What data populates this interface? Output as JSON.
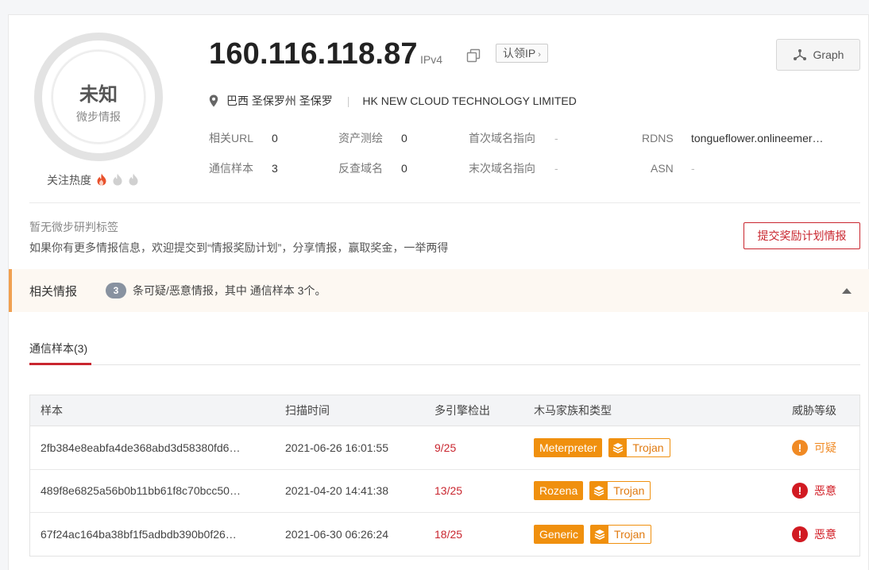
{
  "score": {
    "verdict": "未知",
    "source": "微步情报"
  },
  "heat": {
    "label": "关注热度",
    "level": 1,
    "max": 3,
    "active_color": "#e8522d",
    "inactive_color": "#d0d0d0"
  },
  "ip": {
    "address": "160.116.118.87",
    "version": "IPv4",
    "claim_label": "认领IP"
  },
  "graph_button": {
    "label": "Graph"
  },
  "location": {
    "place": "巴西 圣保罗州 圣保罗",
    "org": "HK NEW CLOUD TECHNOLOGY LIMITED"
  },
  "stats": {
    "related_url": {
      "label": "相关URL",
      "value": "0"
    },
    "asset_map": {
      "label": "资产测绘",
      "value": "0"
    },
    "first_domain": {
      "label": "首次域名指向",
      "value": "-"
    },
    "rdns": {
      "label": "RDNS",
      "value": "tongueflower.onlineemer…"
    },
    "comm_samples": {
      "label": "通信样本",
      "value": "3"
    },
    "reverse_domain": {
      "label": "反查域名",
      "value": "0"
    },
    "last_domain": {
      "label": "末次域名指向",
      "value": "-"
    },
    "asn": {
      "label": "ASN",
      "value": "-"
    }
  },
  "tags": {
    "empty_text": "暂无微步研判标签"
  },
  "reward": {
    "hint": "如果你有更多情报信息，欢迎提交到“情报奖励计划”，分享情报，赢取奖金，一举两得",
    "button_label": "提交奖励计划情报"
  },
  "intel": {
    "title": "相关情报",
    "count": "3",
    "summary": "条可疑/恶意情报，其中 通信样本 3个。"
  },
  "tab": {
    "label": "通信样本(3)"
  },
  "table": {
    "headers": {
      "sample": "样本",
      "scan_time": "扫描时间",
      "detection": "多引擎检出",
      "family": "木马家族和类型",
      "threat": "威胁等级"
    },
    "rows": [
      {
        "hash": "2fb384e8eabfa4de368abd3d58380fd6…",
        "time": "2021-06-26 16:01:55",
        "detection": "9/25",
        "family": "Meterpreter",
        "type": "Trojan",
        "threat": "可疑",
        "threat_color": "#f08a24",
        "threat_icon": "!"
      },
      {
        "hash": "489f8e6825a56b0b11bb61f8c70bcc50…",
        "time": "2021-04-20 14:41:38",
        "detection": "13/25",
        "family": "Rozena",
        "type": "Trojan",
        "threat": "恶意",
        "threat_color": "#d11a22",
        "threat_icon": "!"
      },
      {
        "hash": "67f24ac164ba38bf1f5adbdb390b0f26…",
        "time": "2021-06-30 06:26:24",
        "detection": "18/25",
        "family": "Generic",
        "type": "Trojan",
        "threat": "恶意",
        "threat_color": "#d11a22",
        "threat_icon": "!"
      }
    ]
  },
  "colors": {
    "accent_red": "#c9262f",
    "family_orange": "#f0900e",
    "intel_bar_border": "#f0a050"
  }
}
